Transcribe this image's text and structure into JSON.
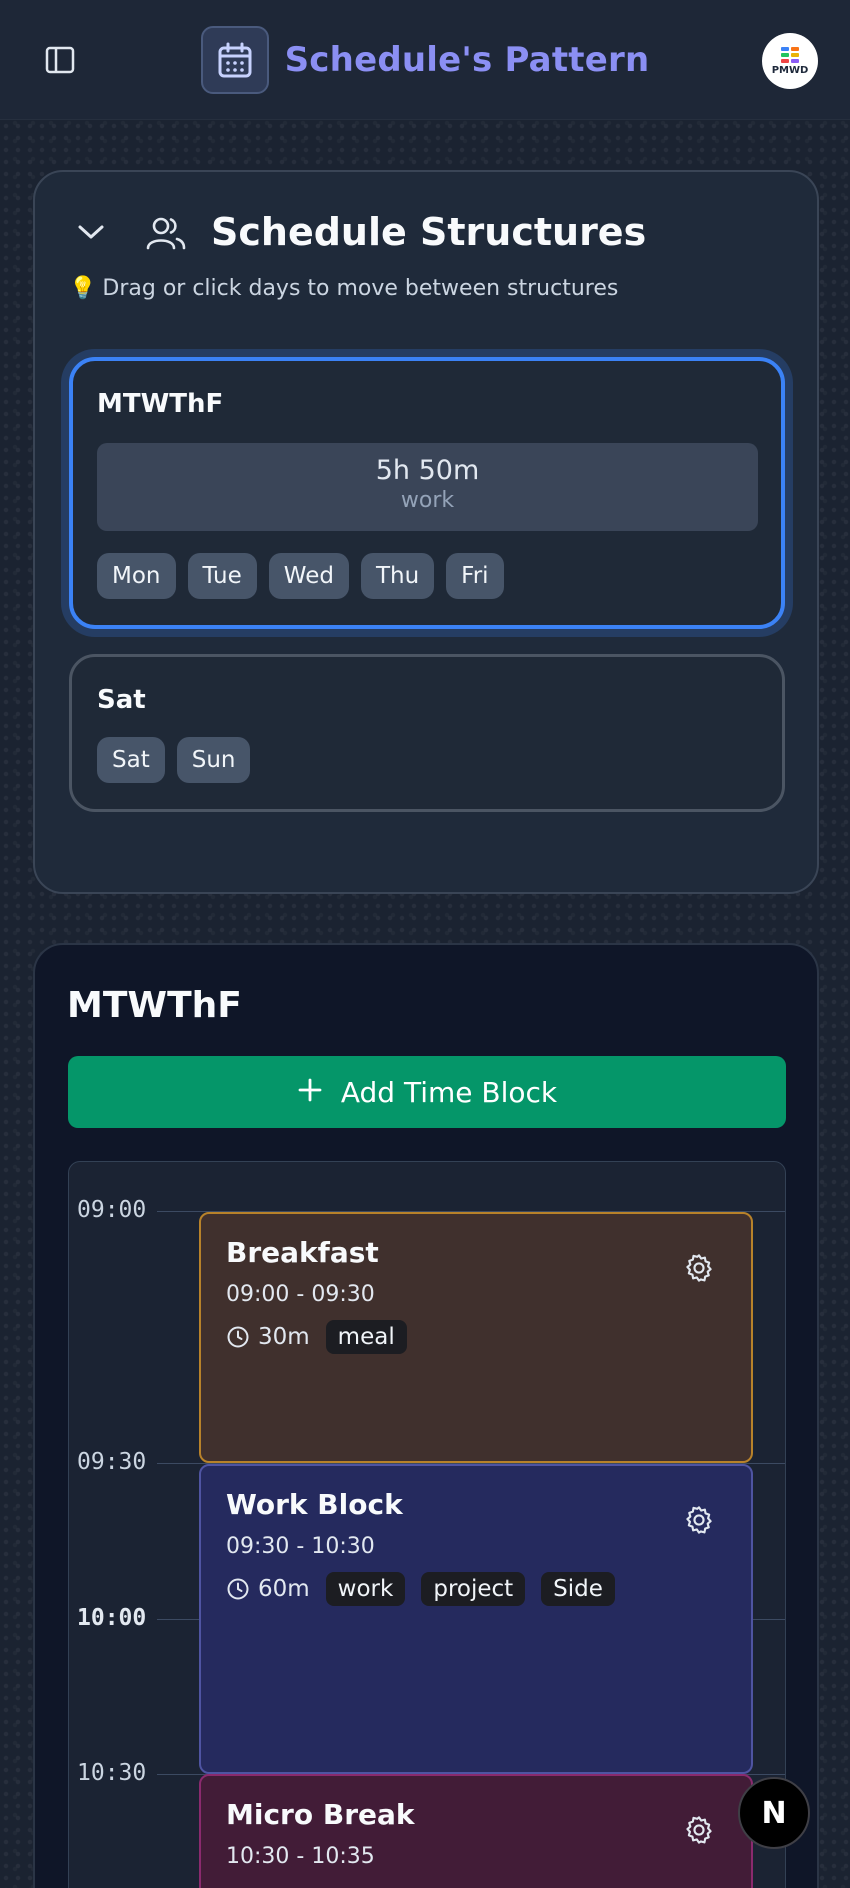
{
  "header": {
    "app_title": "Schedule's Pattern",
    "avatar_text": "PMWD",
    "accent": "#8b8ff3"
  },
  "structures": {
    "title": "Schedule Structures",
    "hint": "Drag or click days to move between structures",
    "hint_emoji": "💡",
    "items": [
      {
        "name": "MTWThF",
        "selected": true,
        "summary_time": "5h 50m",
        "summary_label": "work",
        "days": [
          "Mon",
          "Tue",
          "Wed",
          "Thu",
          "Fri"
        ]
      },
      {
        "name": "Sat",
        "selected": false,
        "days": [
          "Sat",
          "Sun"
        ]
      }
    ]
  },
  "day_view": {
    "title": "MTWThF",
    "add_button_label": "Add Time Block",
    "time_labels": [
      "09:00",
      "09:30",
      "10:00",
      "10:30"
    ],
    "blocks": [
      {
        "title": "Breakfast",
        "time_range": "09:00 - 09:30",
        "duration": "30m",
        "tags": [
          "meal"
        ],
        "color": "#b8822a"
      },
      {
        "title": "Work Block",
        "time_range": "09:30 - 10:30",
        "duration": "60m",
        "tags": [
          "work",
          "project",
          "Side"
        ],
        "color": "#4f54a2"
      },
      {
        "title": "Micro Break",
        "time_range": "10:30 - 10:35",
        "color": "#8a2a6e"
      }
    ]
  },
  "fab": {
    "label": "N"
  }
}
